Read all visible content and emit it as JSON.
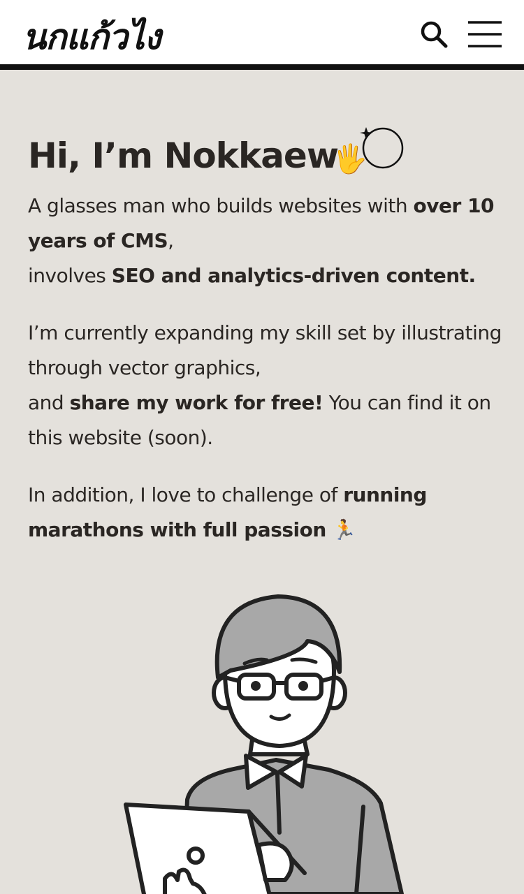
{
  "header": {
    "logo": "นกแก้วไง",
    "search_icon": "search-icon",
    "menu_icon": "hamburger-menu-icon"
  },
  "intro": {
    "title": "Hi, I’m Nokkaew",
    "title_glyph": "🖐",
    "para1": {
      "t1": "A glasses man who builds websites with ",
      "b1": "over 10 years of CMS",
      "t2": ",",
      "t3": "involves ",
      "b2": "SEO and analytics-driven content."
    },
    "para2": {
      "t1": "I’m currently expanding my skill set by illustrating through vector graphics,",
      "t2": "and ",
      "b1": "share my work for free!",
      "t3": " You can find it on this website (soon)."
    },
    "para3": {
      "t1": "In addition, I love to challenge of ",
      "b1": "running marathons with full passion",
      "t2": " 🏃"
    }
  },
  "colors": {
    "background": "#e4e1dc",
    "header_bg": "#ffffff",
    "text": "#2a2623",
    "hair": "#a8a8a8"
  }
}
